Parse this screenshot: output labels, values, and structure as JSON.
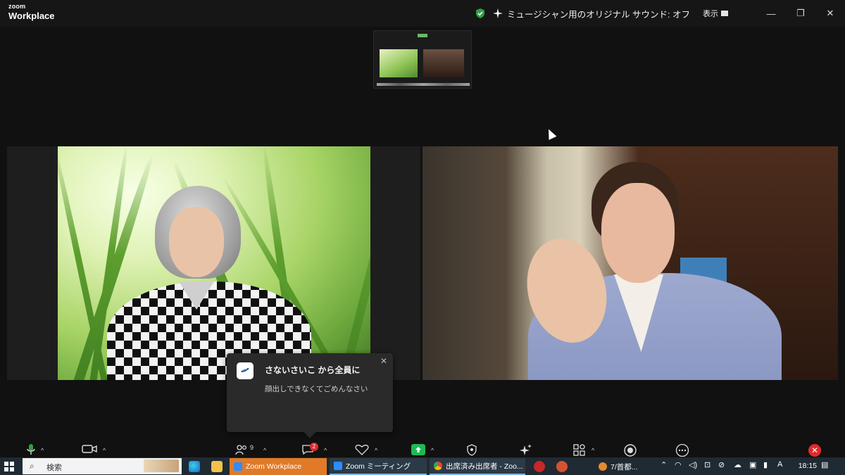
{
  "title_bar": {
    "logo_small": "zoom",
    "logo_large": "Workplace",
    "music_mode": "ミュージシャン用のオリジナル サウンド: オフ",
    "view_label": "表示",
    "minimize": "—",
    "restore": "❐",
    "close": "✕"
  },
  "notification": {
    "sender": "さないさいこ から全員に",
    "message": "顔出しできなくてごめんなさい",
    "close": "✕"
  },
  "toolbar": {
    "participants_count": "9",
    "chat_badge": "2",
    "caret": "^",
    "end_icon": "✕"
  },
  "taskbar": {
    "search_placeholder": "検索",
    "tasks": [
      "Zoom Workplace",
      "Zoom ミーティング",
      "出席済み出席者 - Zoo...",
      "7/首都..."
    ],
    "ime": "A",
    "time": "18:15"
  },
  "colors": {
    "accent_green": "#1db954",
    "end_red": "#e02a2a",
    "active_task": "#e07a28"
  }
}
